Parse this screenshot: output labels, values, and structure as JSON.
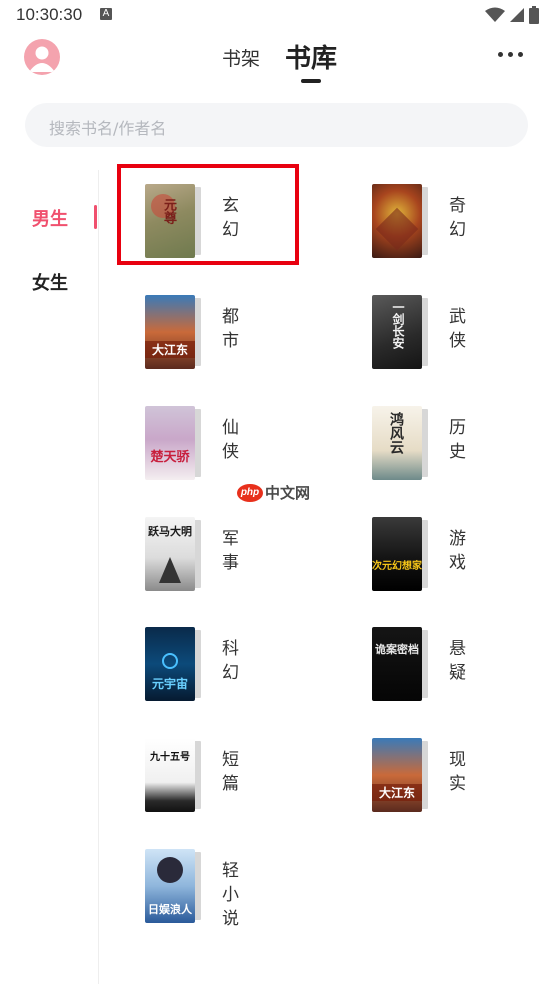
{
  "status": {
    "time": "10:30:30",
    "indicator": "A"
  },
  "header": {
    "tab_shelf": "书架",
    "tab_library": "书库"
  },
  "search": {
    "placeholder": "搜索书名/作者名"
  },
  "sidebar": {
    "items": [
      {
        "label": "男生"
      },
      {
        "label": "女生"
      }
    ]
  },
  "categories": [
    {
      "label": "玄幻",
      "cover_text": "元尊"
    },
    {
      "label": "奇幻",
      "cover_text": ""
    },
    {
      "label": "都市",
      "cover_text": "大江东"
    },
    {
      "label": "武侠",
      "cover_text": "一剑长安"
    },
    {
      "label": "仙侠",
      "cover_text": "楚天骄"
    },
    {
      "label": "历史",
      "cover_text": "鸿风云"
    },
    {
      "label": "军事",
      "cover_text": "跃马大明"
    },
    {
      "label": "游戏",
      "cover_text": "次元幻想家"
    },
    {
      "label": "科幻",
      "cover_text": "元宇宙"
    },
    {
      "label": "悬疑",
      "cover_text": "诡案密档"
    },
    {
      "label": "短篇",
      "cover_text": "九十五号"
    },
    {
      "label": "现实",
      "cover_text": "大江东"
    },
    {
      "label": "轻小说",
      "cover_text": "日娱浪人"
    }
  ],
  "watermark": {
    "logo": "php",
    "text": "中文网"
  },
  "colors": {
    "accent": "#f0506e",
    "highlight": "#e8000f",
    "search_bg": "#f4f5f7"
  }
}
